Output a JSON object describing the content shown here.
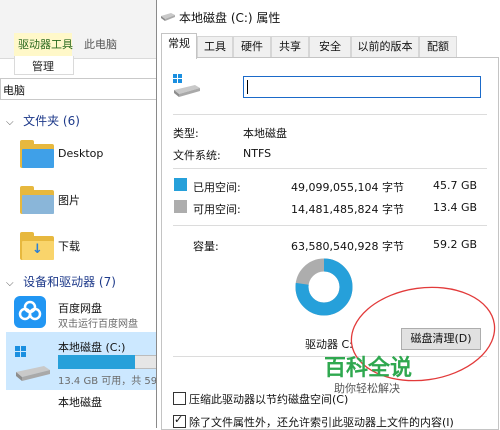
{
  "explorer": {
    "ribbon": {
      "context_tab": "驱动器工具",
      "this_pc_tab": "此电脑",
      "manage_tab": "管理"
    },
    "address": "电脑",
    "folders_header": "文件夹 (6)",
    "folders": [
      {
        "label": "Desktop"
      },
      {
        "label": "图片"
      },
      {
        "label": "下载"
      }
    ],
    "devices_header": "设备和驱动器 (7)",
    "baidu": {
      "name": "百度网盘",
      "sub": "双击运行百度网盘"
    },
    "local_disk": {
      "name": "本地磁盘 (C:)",
      "sub": "13.4 GB 可用，共 59",
      "used_fraction": 0.77
    },
    "next_item": "本地磁盘"
  },
  "dialog": {
    "title": "本地磁盘 (C:) 属性",
    "window_buttons": {
      "minimize": "—",
      "close": "✕"
    },
    "tabs": [
      "常规",
      "工具",
      "硬件",
      "共享",
      "安全",
      "以前的版本",
      "配额"
    ],
    "active_tab": "常规",
    "name_input": "",
    "type_label": "类型:",
    "type_value": "本地磁盘",
    "fs_label": "文件系统:",
    "fs_value": "NTFS",
    "used": {
      "label": "已用空间:",
      "bytes": "49,099,055,104 字节",
      "size": "45.7 GB",
      "color": "#26a0da"
    },
    "free": {
      "label": "可用空间:",
      "bytes": "14,481,485,824 字节",
      "size": "13.4 GB",
      "color": "#adadad"
    },
    "capacity": {
      "label": "容量:",
      "bytes": "63,580,540,928 字节",
      "size": "59.2 GB"
    },
    "used_fraction": 0.772,
    "drive_label": "驱动器 C:",
    "cleanup_button": "磁盘清理(D)",
    "compress_checkbox": {
      "label": "压缩此驱动器以节约磁盘空间(C)",
      "checked": false
    },
    "index_checkbox": {
      "label": "除了文件属性外，还允许索引此驱动器上文件的内容(I)",
      "checked": true
    }
  },
  "watermark": {
    "title": "百科全说",
    "subtitle": "助你轻松解决"
  }
}
